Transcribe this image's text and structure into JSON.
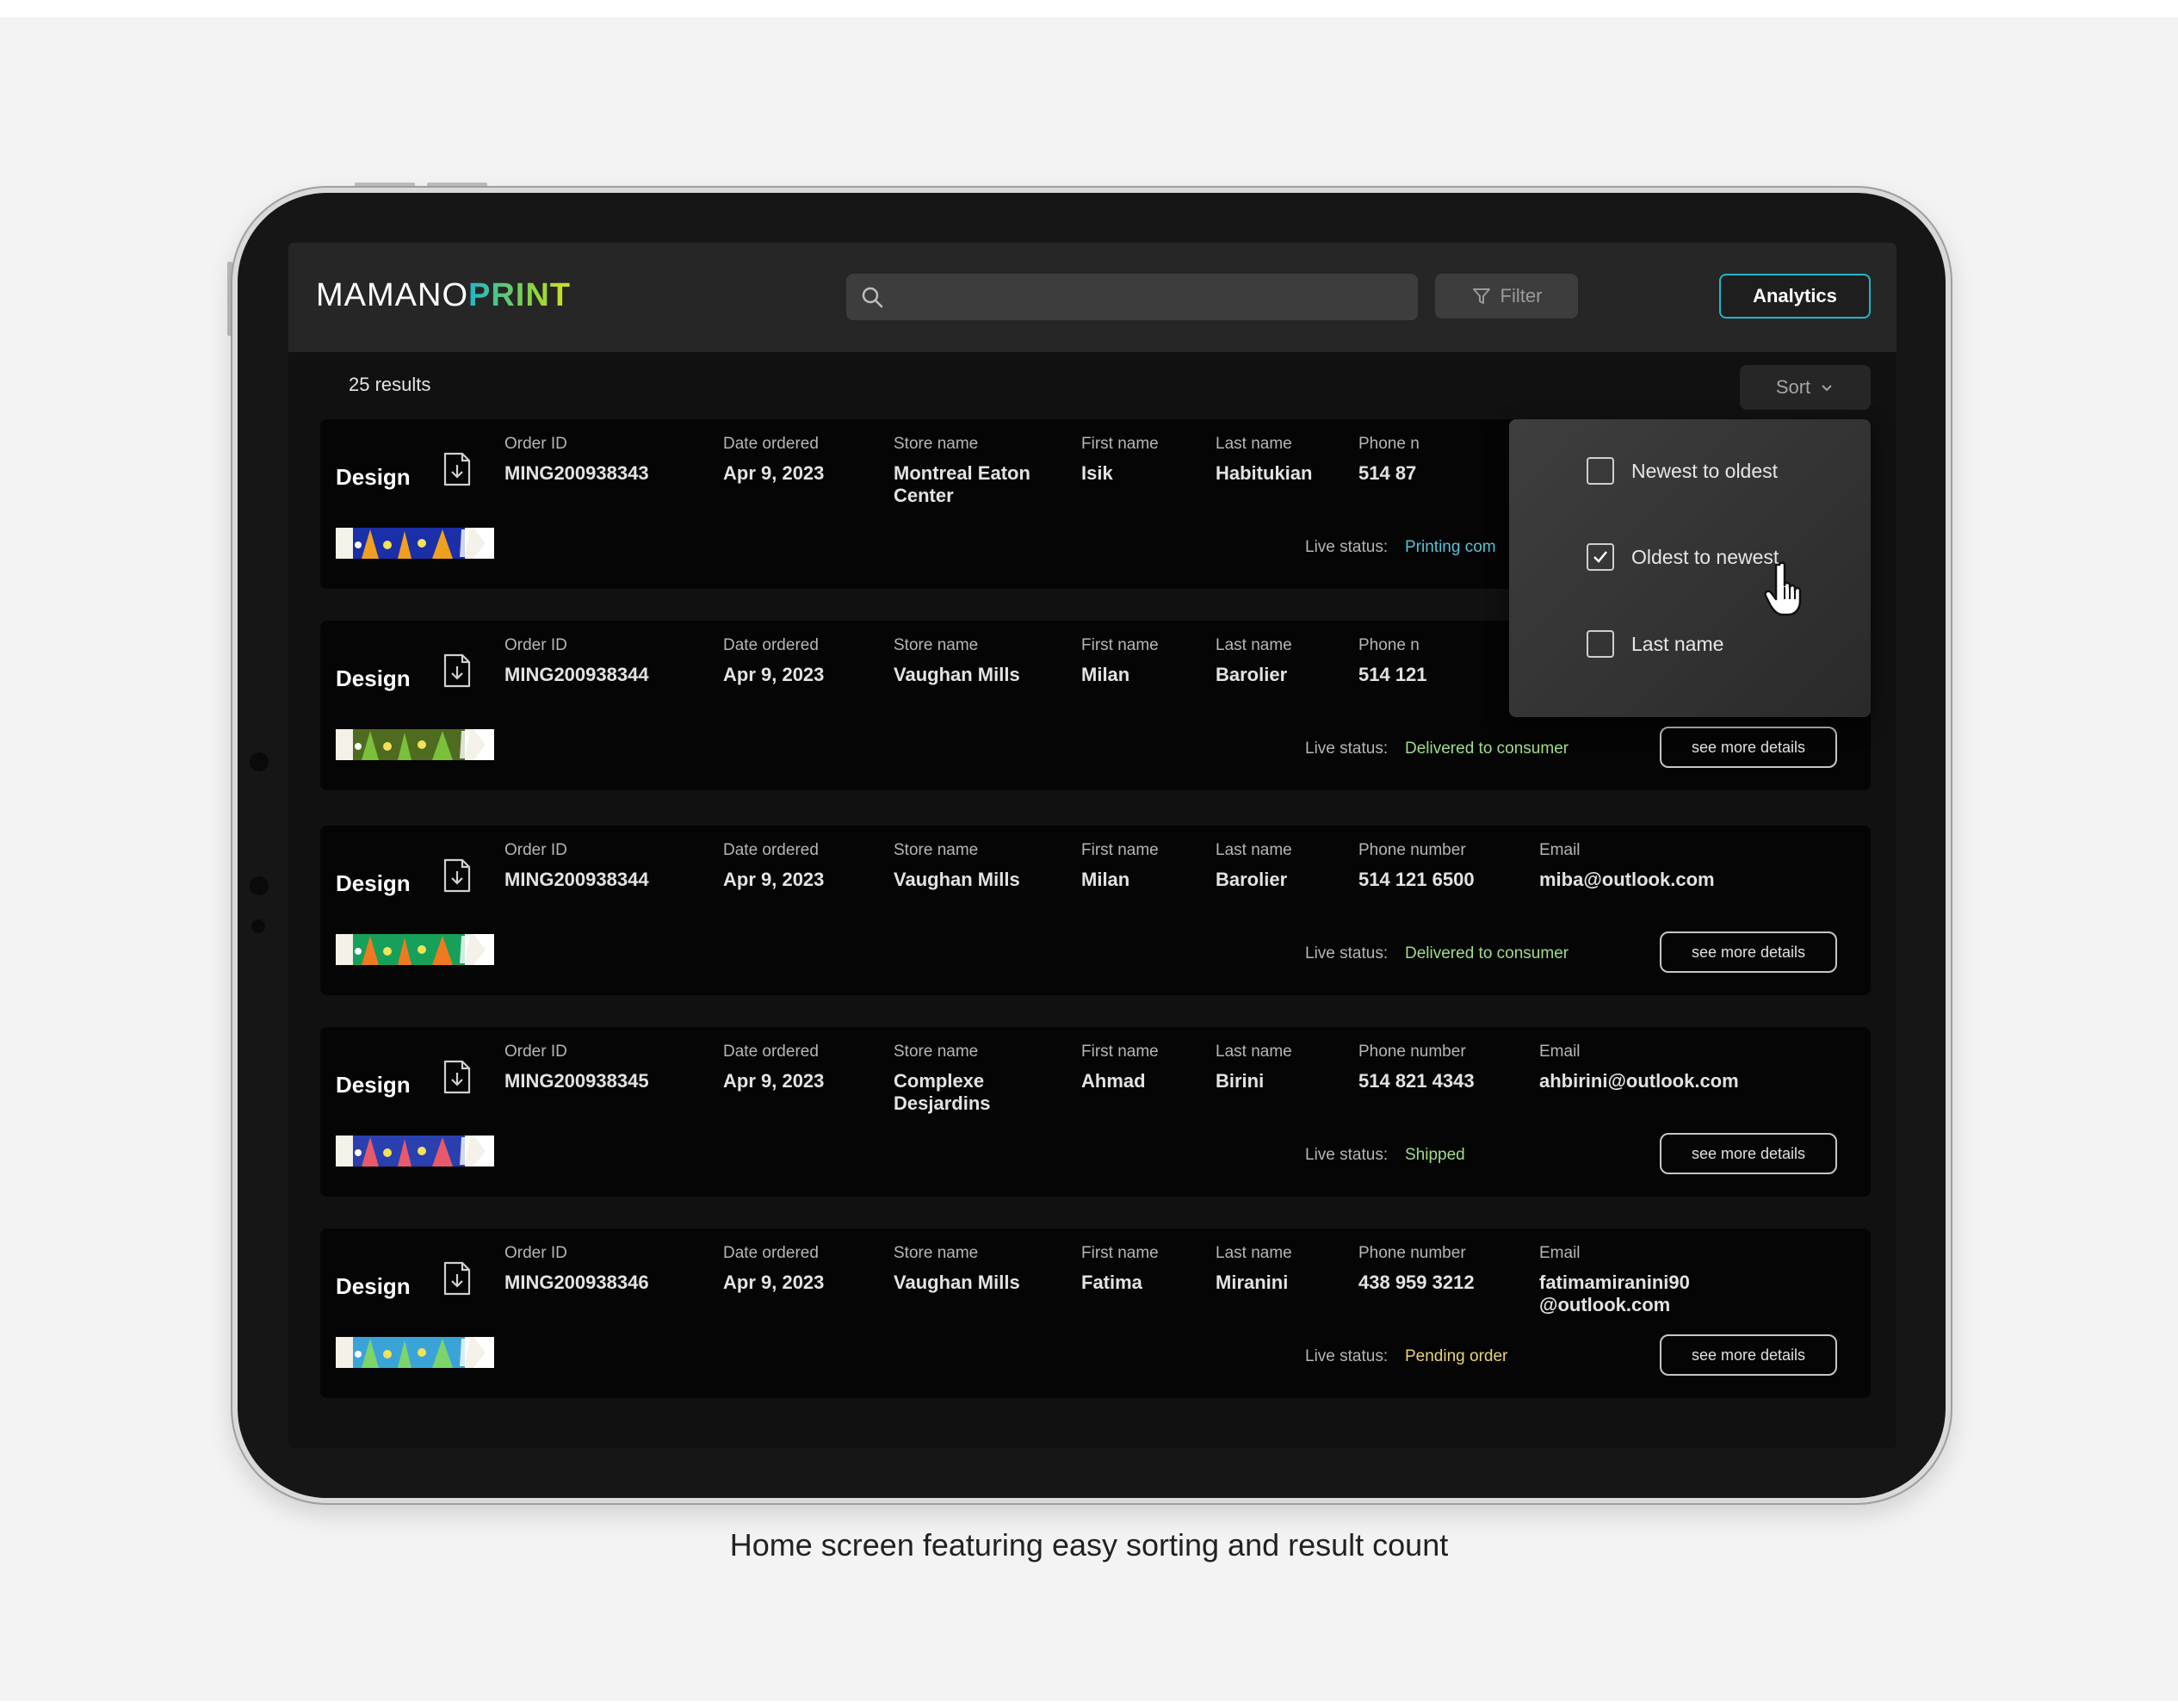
{
  "app": {
    "logo_left": "MAMANO",
    "logo_right": "PRINT",
    "search_placeholder": "",
    "filter_label": "Filter",
    "analytics_label": "Analytics"
  },
  "results_count": "25 results",
  "sort": {
    "label": "Sort",
    "options": [
      {
        "label": "Newest to oldest",
        "checked": false
      },
      {
        "label": "Oldest to newest",
        "checked": true
      },
      {
        "label": "Last name",
        "checked": false
      }
    ]
  },
  "columns": {
    "order_id": "Order ID",
    "date_ordered": "Date ordered",
    "store_name": "Store name",
    "first_name": "First name",
    "last_name": "Last name",
    "phone_number": "Phone number",
    "phone_number_truncated": "Phone n",
    "email": "Email"
  },
  "design_label": "Design",
  "live_status_label": "Live status:",
  "details_label": "see more details",
  "orders": [
    {
      "order_id": "MING200938343",
      "date": "Apr 9, 2023",
      "store": "Montreal Eaton Center",
      "first": "Isik",
      "last": "Habitukian",
      "phone": "514 87",
      "email": "",
      "status": "Printing com",
      "status_color": "#56c3d6",
      "thumb_bg": "#1a2fa8",
      "thumb_accent": "#f0a020"
    },
    {
      "order_id": "MING200938344",
      "date": "Apr 9, 2023",
      "store": "Vaughan Mills",
      "first": "Milan",
      "last": "Barolier",
      "phone": "514 121",
      "email": "",
      "status": "Delivered to consumer",
      "status_color": "#9fdc8a",
      "thumb_bg": "#4f6b1f",
      "thumb_accent": "#7bbf3a"
    },
    {
      "order_id": "MING200938344",
      "date": "Apr 9, 2023",
      "store": "Vaughan Mills",
      "first": "Milan",
      "last": "Barolier",
      "phone": "514 121 6500",
      "email": "miba@outlook.com",
      "status": "Delivered to consumer",
      "status_color": "#9fdc8a",
      "thumb_bg": "#16a05a",
      "thumb_accent": "#f07a20"
    },
    {
      "order_id": "MING200938345",
      "date": "Apr 9, 2023",
      "store": "Complexe Desjardins",
      "first": "Ahmad",
      "last": "Birini",
      "phone": "514 821 4343",
      "email": "ahbirini@outlook.com",
      "status": "Shipped",
      "status_color": "#9fdc8a",
      "thumb_bg": "#2a3fb0",
      "thumb_accent": "#e85a6a"
    },
    {
      "order_id": "MING200938346",
      "date": "Apr 9, 2023",
      "store": "Vaughan Mills",
      "first": "Fatima",
      "last": "Miranini",
      "phone": "438 959 3212",
      "email": "fatimamiranini90 @outlook.com",
      "status": "Pending order",
      "status_color": "#e8d37a",
      "thumb_bg": "#3aa4d8",
      "thumb_accent": "#7cd46a"
    }
  ],
  "caption": "Home screen featuring easy sorting and result count",
  "colors": {
    "accent": "#1fb6c9",
    "background": "#111111"
  }
}
